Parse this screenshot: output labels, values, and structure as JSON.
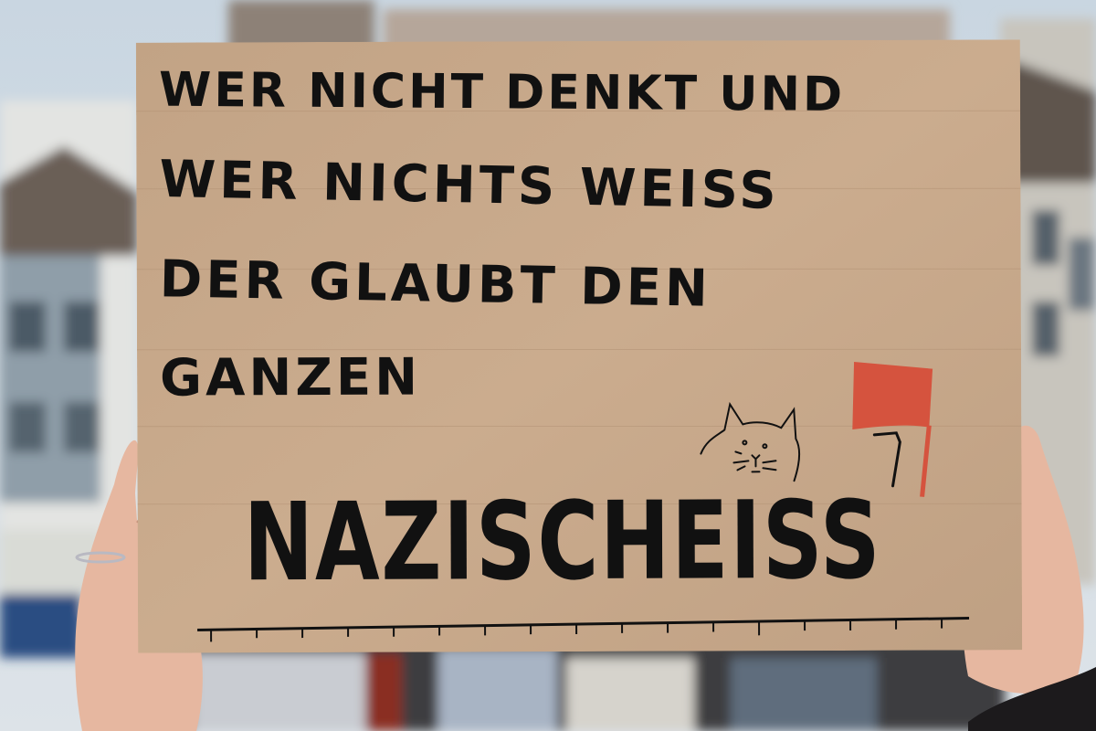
{
  "sign": {
    "line1": "WER NICHT DENKT UND",
    "line2": "WER NICHTS WEISS",
    "line3": "DER GLAUBT DEN",
    "line4": "GANZEN",
    "headline": "NAZISCHEISS"
  },
  "colors": {
    "cardboard": "#c6a788",
    "ink": "#111111",
    "flag": "#d5533e",
    "skin": "#e6b7a0",
    "nail_polish": "#1d1f2c"
  },
  "icons": [
    "cat-doodle-icon",
    "red-flag-icon",
    "ring-icon"
  ]
}
